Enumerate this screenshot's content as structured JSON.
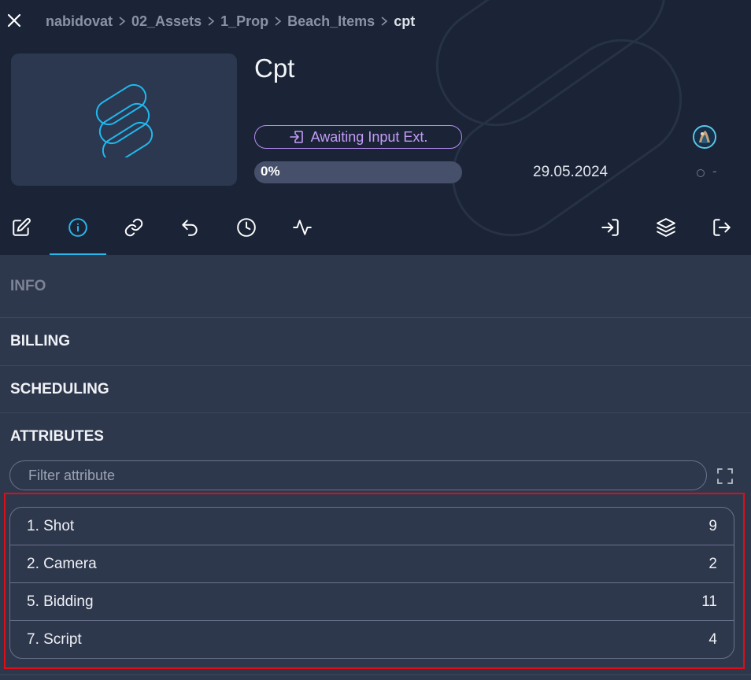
{
  "header": {
    "breadcrumb": [
      "nabidovat",
      "02_Assets",
      "1_Prop",
      "Beach_Items",
      "cpt"
    ],
    "title": "Cpt",
    "status_label": "Awaiting Input Ext.",
    "progress_text": "0%",
    "progress_fraction": 0,
    "date": "29.05.2024",
    "meta_value": "-"
  },
  "tabs": {
    "left": [
      "edit-icon",
      "info-icon",
      "link-icon",
      "history-icon",
      "clock-icon",
      "activity-icon"
    ],
    "right": [
      "log-in-icon",
      "layers-icon",
      "log-out-icon"
    ],
    "active": "info-icon"
  },
  "sections": {
    "info": "INFO",
    "billing": "BILLING",
    "scheduling": "SCHEDULING",
    "attributes": "ATTRIBUTES"
  },
  "filter": {
    "placeholder": "Filter attribute"
  },
  "attributes": [
    {
      "label": "1. Shot",
      "count": "9"
    },
    {
      "label": "2. Camera",
      "count": "2"
    },
    {
      "label": "5. Bidding",
      "count": "11"
    },
    {
      "label": "7. Script",
      "count": "4"
    }
  ],
  "colors": {
    "header_bg": "#1b2436",
    "panel_bg": "#2e384c",
    "accent_blue": "#29b8ec",
    "status_purple": "#c39bf7",
    "highlight_red": "#e00c16"
  }
}
